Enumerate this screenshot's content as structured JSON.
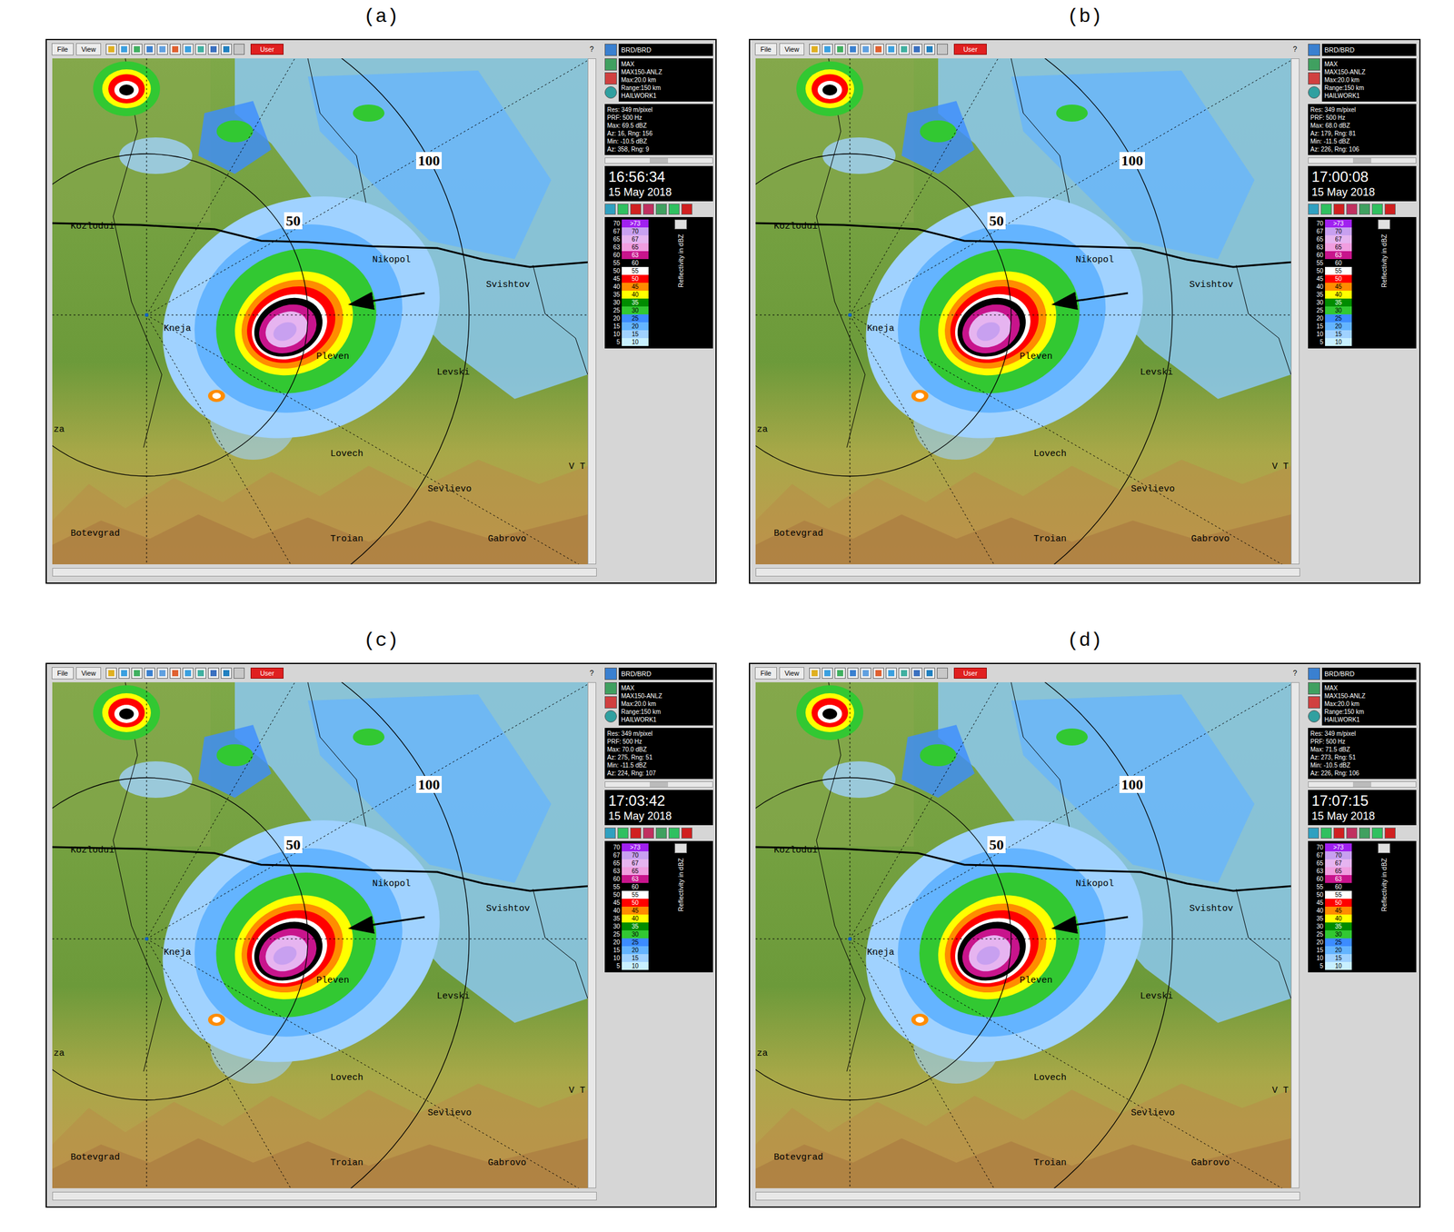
{
  "window": {
    "menus": [
      "File",
      "View"
    ],
    "user_button": "User",
    "help": "?"
  },
  "sidebar": {
    "site": "BRD/BRD",
    "product_lines": [
      "MAX",
      "MAX150-ANLZ",
      "Max:20.0 km",
      "Range:150 km",
      "HAILWORK1"
    ],
    "res": "Res: 349 m/pixel",
    "prf": "PRF: 500 Hz"
  },
  "legend": {
    "title": "Reflectivity in dBZ",
    "rows": [
      {
        "from": "70",
        "to": ">73",
        "color": "#a020f0"
      },
      {
        "from": "67",
        "to": "70",
        "color": "#c8a0f0"
      },
      {
        "from": "65",
        "to": "67",
        "color": "#e6b4f0"
      },
      {
        "from": "63",
        "to": "65",
        "color": "#f09ee0"
      },
      {
        "from": "60",
        "to": "63",
        "color": "#c8148c"
      },
      {
        "from": "55",
        "to": "60",
        "color": "#000000"
      },
      {
        "from": "50",
        "to": "55",
        "color": "#ffffff"
      },
      {
        "from": "45",
        "to": "50",
        "color": "#ff0000"
      },
      {
        "from": "40",
        "to": "45",
        "color": "#ff8c00"
      },
      {
        "from": "35",
        "to": "40",
        "color": "#ffff00"
      },
      {
        "from": "30",
        "to": "35",
        "color": "#008c00"
      },
      {
        "from": "25",
        "to": "30",
        "color": "#32c832"
      },
      {
        "from": "20",
        "to": "25",
        "color": "#3c8cff"
      },
      {
        "from": "15",
        "to": "20",
        "color": "#64b4ff"
      },
      {
        "from": "10",
        "to": "15",
        "color": "#a0d2ff"
      },
      {
        "from": "5",
        "to": "10",
        "color": "#c8f0ff"
      }
    ]
  },
  "map": {
    "cities": [
      "Kozlodui",
      "Nikopol",
      "Svishtov",
      "Kneja",
      "Pleven",
      "Levski",
      "Lovech",
      "Sevlievo",
      "Botevgrad",
      "Troian",
      "Gabrovo",
      "za",
      "V T"
    ],
    "range_labels": [
      "50",
      "100"
    ]
  },
  "panels": [
    {
      "label": "(a)",
      "time": "16:56:34",
      "date": "15 May 2018",
      "readings": [
        "Max: 69.5 dBZ",
        "Az: 16, Rng: 156",
        "Min: -10.5 dBZ",
        "Az: 358, Rng: 9"
      ]
    },
    {
      "label": "(b)",
      "time": "17:00:08",
      "date": "15 May 2018",
      "readings": [
        "Max: 68.0 dBZ",
        "Az: 179, Rng: 81",
        "Min: -11.5 dBZ",
        "Az: 226, Rng: 106"
      ]
    },
    {
      "label": "(c)",
      "time": "17:03:42",
      "date": "15 May 2018",
      "readings": [
        "Max: 70.0 dBZ",
        "Az: 275, Rng: 51",
        "Min: -11.5 dBZ",
        "Az: 224, Rng: 107"
      ]
    },
    {
      "label": "(d)",
      "time": "17:07:15",
      "date": "15 May 2018",
      "readings": [
        "Max: 71.5 dBZ",
        "Az: 273, Rng: 51",
        "Min: -10.5 dBZ",
        "Az: 226, Rng: 106"
      ]
    }
  ]
}
